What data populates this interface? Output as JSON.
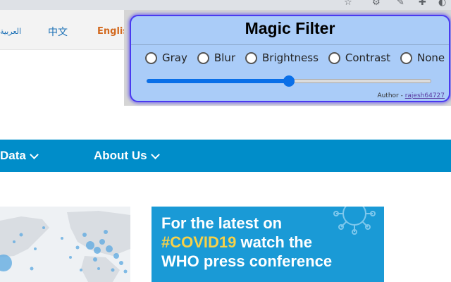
{
  "browser": {
    "icons": [
      "star-icon",
      "extension-icon",
      "edit-icon",
      "puzzle-icon",
      "profile-icon"
    ]
  },
  "langbar": {
    "arabic": "العربية",
    "chinese": "中文",
    "english": "Englis"
  },
  "nav": {
    "items": [
      {
        "label": "Data"
      },
      {
        "label": "About Us"
      }
    ]
  },
  "banner": {
    "line1": "For the latest on",
    "hashtag": "#COVID19",
    "line2_rest": " watch the",
    "line3": "WHO press conference"
  },
  "popup": {
    "title": "Magic Filter",
    "options": [
      {
        "label": "Gray"
      },
      {
        "label": "Blur"
      },
      {
        "label": "Brightness"
      },
      {
        "label": "Contrast"
      },
      {
        "label": "None"
      }
    ],
    "slider_value": 0.5,
    "author_prefix": "Author - ",
    "author_link": "rajesh64727"
  },
  "colors": {
    "nav_bg": "#008dc9",
    "popup_bg": "#aaccf8",
    "popup_border": "#4a3af0",
    "slider_accent": "#0a6fe8",
    "banner_bg": "#1a9ad6",
    "banner_highlight": "#f7d148"
  }
}
